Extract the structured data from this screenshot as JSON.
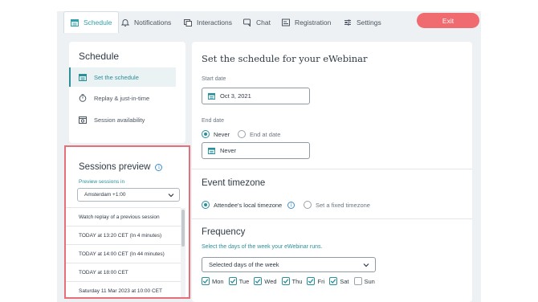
{
  "tabs": [
    {
      "label": "Schedule",
      "icon": "calendar-icon",
      "active": true
    },
    {
      "label": "Notifications",
      "icon": "bell-icon"
    },
    {
      "label": "Interactions",
      "icon": "interactions-icon"
    },
    {
      "label": "Chat",
      "icon": "chat-icon"
    },
    {
      "label": "Registration",
      "icon": "registration-icon"
    },
    {
      "label": "Settings",
      "icon": "sliders-icon"
    }
  ],
  "exit_label": "Exit",
  "sidebar": {
    "title": "Schedule",
    "items": [
      {
        "label": "Set the schedule",
        "icon": "calendar-icon",
        "active": true
      },
      {
        "label": "Replay & just-in-time",
        "icon": "stopwatch-icon"
      },
      {
        "label": "Session availability",
        "icon": "calendar-clock-icon"
      }
    ]
  },
  "sessions_preview": {
    "title": "Sessions preview",
    "subtitle": "Preview sessions in",
    "timezone_value": "Amsterdam +1:00",
    "rows": [
      "Watch replay of a previous session",
      "TODAY at 13:20 CET (In 4 minutes)",
      "TODAY at 14:00 CET (In 44 minutes)",
      "TODAY at 18:00 CET",
      "Saturday 11 Mar 2023 at 10:00 CET"
    ]
  },
  "main": {
    "title": "Set the schedule for your eWebinar",
    "start_date_label": "Start date",
    "start_date_value": "Oct 3, 2021",
    "end_date_label": "End date",
    "end_never_label": "Never",
    "end_at_date_label": "End at date",
    "end_date_value": "Never",
    "timezone_title": "Event timezone",
    "tz_local_label": "Attendee's local timezone",
    "tz_fixed_label": "Set a fixed timezone",
    "frequency_title": "Frequency",
    "frequency_desc": "Select the days of the week your eWebinar runs.",
    "frequency_select_value": "Selected days of the week",
    "days": [
      {
        "label": "Mon",
        "checked": true
      },
      {
        "label": "Tue",
        "checked": true
      },
      {
        "label": "Wed",
        "checked": true
      },
      {
        "label": "Thu",
        "checked": true
      },
      {
        "label": "Fri",
        "checked": true
      },
      {
        "label": "Sat",
        "checked": true
      },
      {
        "label": "Sun",
        "checked": false
      }
    ]
  },
  "colors": {
    "accent": "#2a8f99",
    "exit": "#ef6b6f",
    "highlight_border": "#e5707a"
  }
}
